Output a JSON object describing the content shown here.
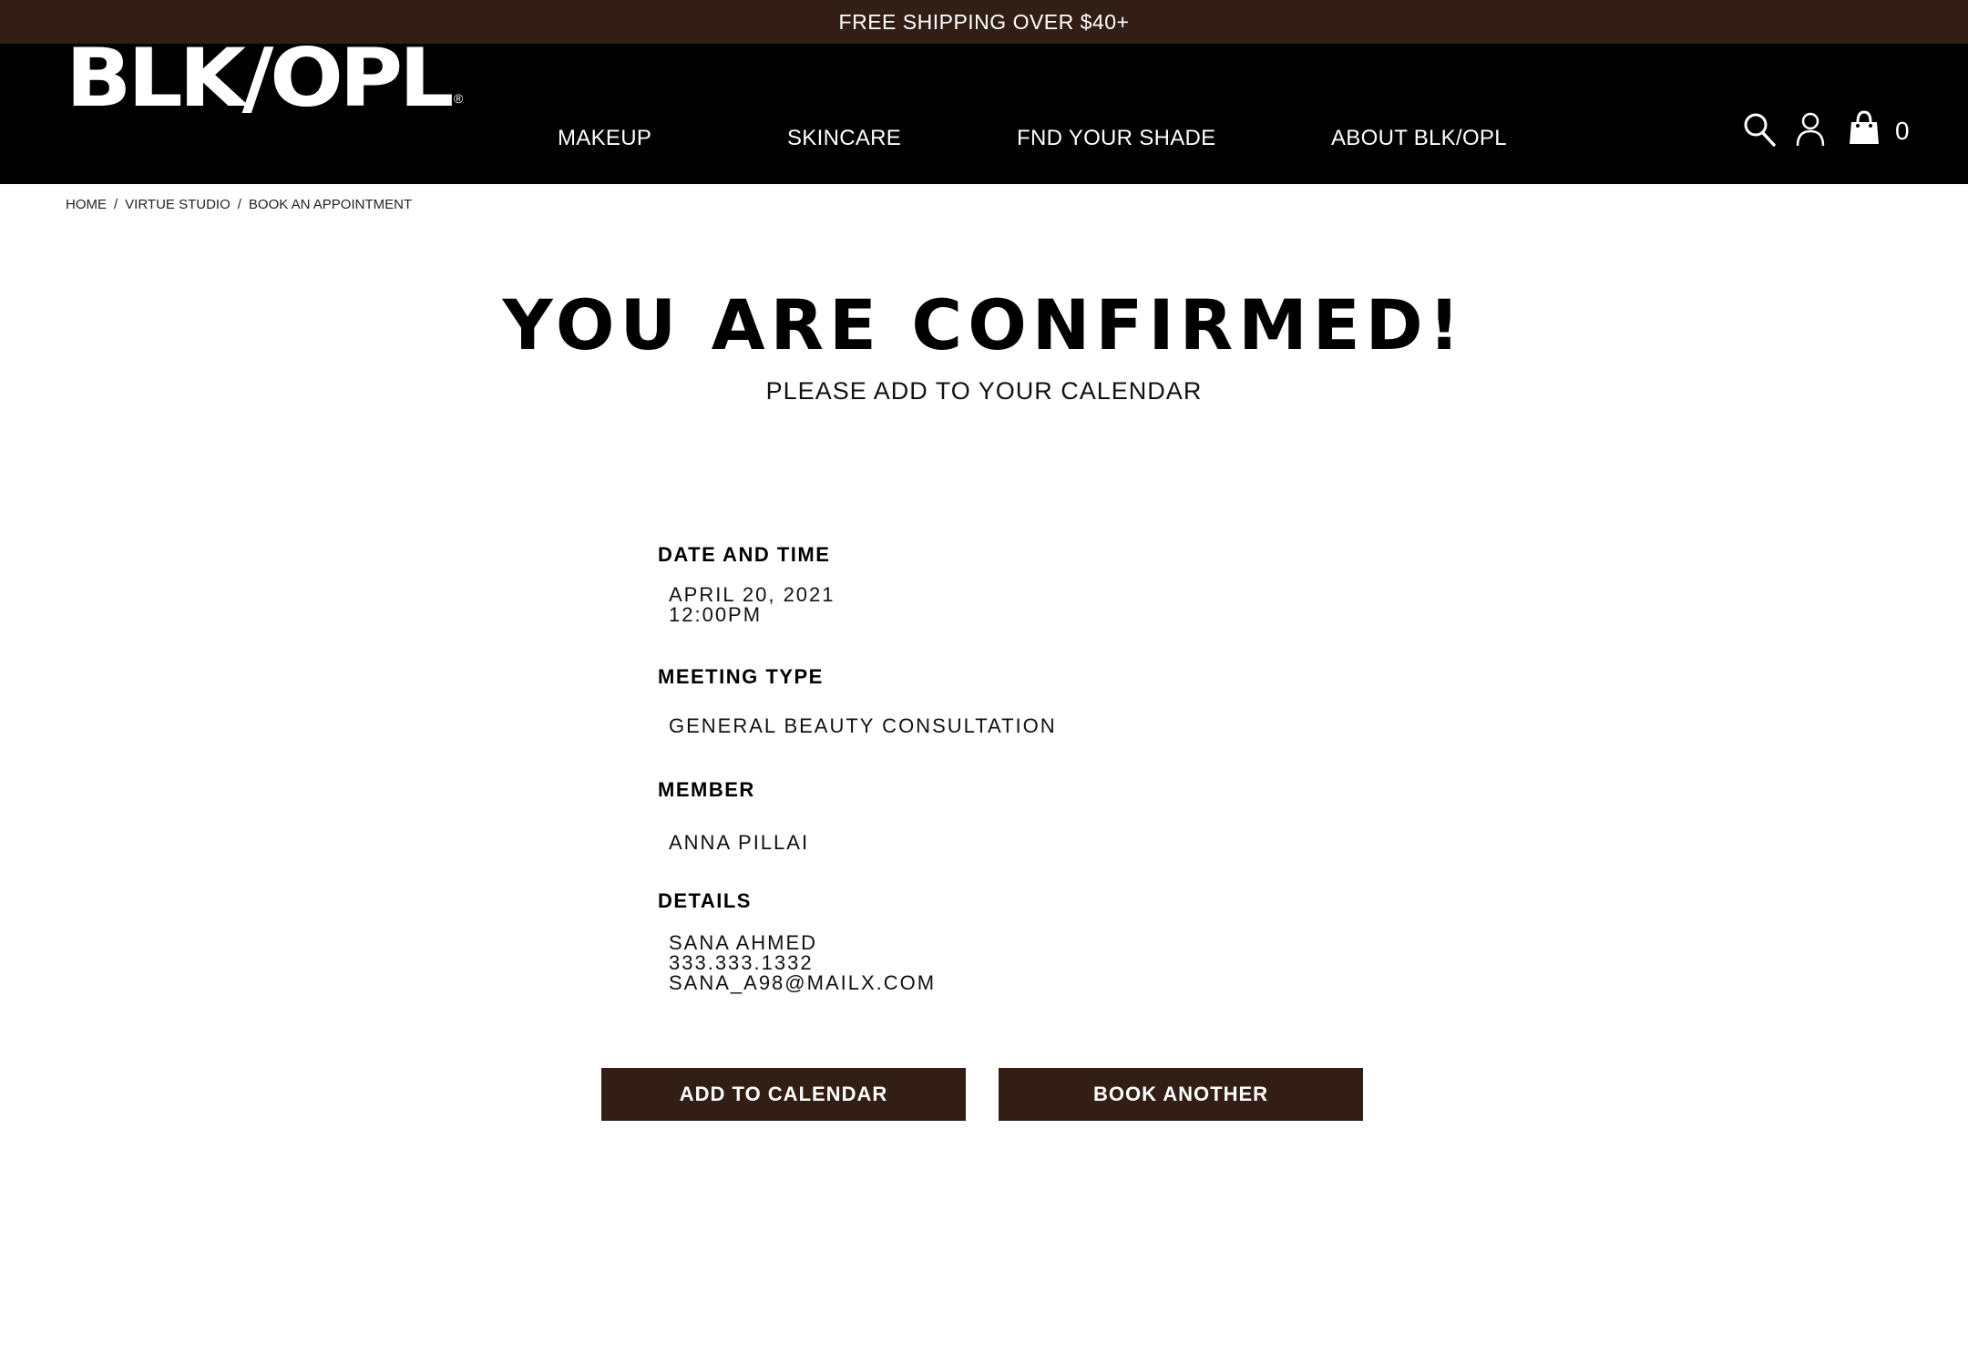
{
  "promo": {
    "text": "FREE SHIPPING OVER $40+"
  },
  "header": {
    "logo": "BLK/OPL",
    "logo_mark": "®",
    "nav": [
      {
        "label": "MAKEUP"
      },
      {
        "label": "SKINCARE"
      },
      {
        "label": "FND YOUR SHADE"
      },
      {
        "label": "ABOUT BLK/OPL"
      }
    ],
    "icons": [
      "search-icon",
      "account-icon",
      "shopping-bag-icon"
    ],
    "cart_count": "0"
  },
  "breadcrumb": {
    "items": [
      "HOME",
      "VIRTUE STUDIO",
      "BOOK AN APPOINTMENT"
    ],
    "separator": "/"
  },
  "confirmation": {
    "title": "YOU ARE CONFIRMED!",
    "subtitle": "PLEASE ADD TO YOUR CALENDAR",
    "date_time": {
      "label": "DATE AND TIME",
      "date": "APRIL 20, 2021",
      "time": "12:00PM"
    },
    "meeting_type": {
      "label": "MEETING TYPE",
      "value": "GENERAL BEAUTY CONSULTATION"
    },
    "member": {
      "label": "MEMBER",
      "value": "ANNA PILLAI"
    },
    "details": {
      "label": "DETAILS",
      "name": "SANA AHMED",
      "phone": "333.333.1332",
      "email": "SANA_A98@MAILX.COM"
    }
  },
  "actions": {
    "add_to_calendar": "ADD TO CALENDAR",
    "book_another": "BOOK ANOTHER"
  },
  "colors": {
    "brand_brown": "#331e16",
    "header_black": "#000000",
    "text_white": "#ffffff"
  }
}
